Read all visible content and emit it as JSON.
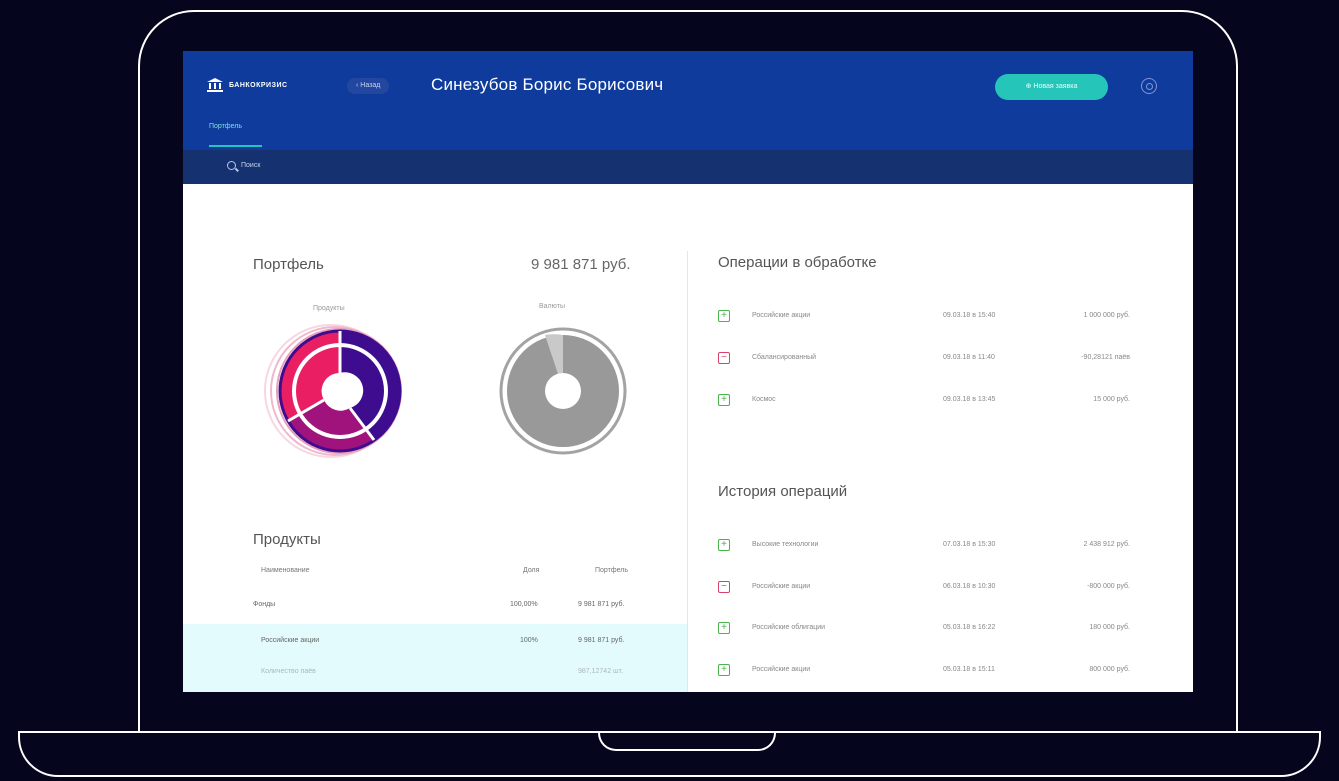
{
  "header": {
    "logo": "БАНКОКРИЗИС",
    "back_label": "‹ Назад",
    "client_name": "Синезубов Борис Борисович",
    "new_request": "⊕ Новая заявка"
  },
  "tabs": [
    {
      "label": "Портфель"
    }
  ],
  "search": {
    "placeholder": "Поиск"
  },
  "portfolio": {
    "title": "Портфель",
    "total": "9 981 871 руб.",
    "products_chart_label": "Продукты",
    "currency_chart_label": "Валюты"
  },
  "products": {
    "title": "Продукты",
    "col_name": "Наименование",
    "col_share": "Доля",
    "col_portfolio": "Портфель",
    "rows": [
      {
        "name": "Фонды",
        "share": "100,00%",
        "value": "9 981 871 руб."
      },
      {
        "name": "Российские акции",
        "share": "100%",
        "value": "9 981 871 руб."
      },
      {
        "name": "Количество паёв",
        "share": "",
        "value": "987,12742 шт."
      }
    ]
  },
  "operations": {
    "title": "Операции в обработке",
    "items": [
      {
        "type": "plus",
        "name": "Российские акции",
        "date": "09.03.18 в 15:40",
        "amount": "1 000 000 руб."
      },
      {
        "type": "minus",
        "name": "Сбалансированный",
        "date": "09.03.18 в 11:40",
        "amount": "-90,28121 паёв"
      },
      {
        "type": "plus",
        "name": "Космос",
        "date": "09.03.18 в 13:45",
        "amount": "15 000 руб."
      }
    ]
  },
  "history": {
    "title": "История операций",
    "items": [
      {
        "type": "plus",
        "name": "Высокие технологии",
        "date": "07.03.18 в 15:30",
        "amount": "2 438 912 руб."
      },
      {
        "type": "minus",
        "name": "Российские акции",
        "date": "06.03.18 в 10:30",
        "amount": "-800 000 руб."
      },
      {
        "type": "plus",
        "name": "Российские облигации",
        "date": "05.03.18 в 16:22",
        "amount": "180 000 руб."
      },
      {
        "type": "plus",
        "name": "Российские акции",
        "date": "05.03.18 в 15:11",
        "amount": "800 000 руб."
      }
    ]
  },
  "colors": {
    "accent": "#25c5b9",
    "header": "#0e3b9c",
    "pink": "#e91e63",
    "magenta": "#a0127c",
    "purple": "#3d0c8f"
  }
}
